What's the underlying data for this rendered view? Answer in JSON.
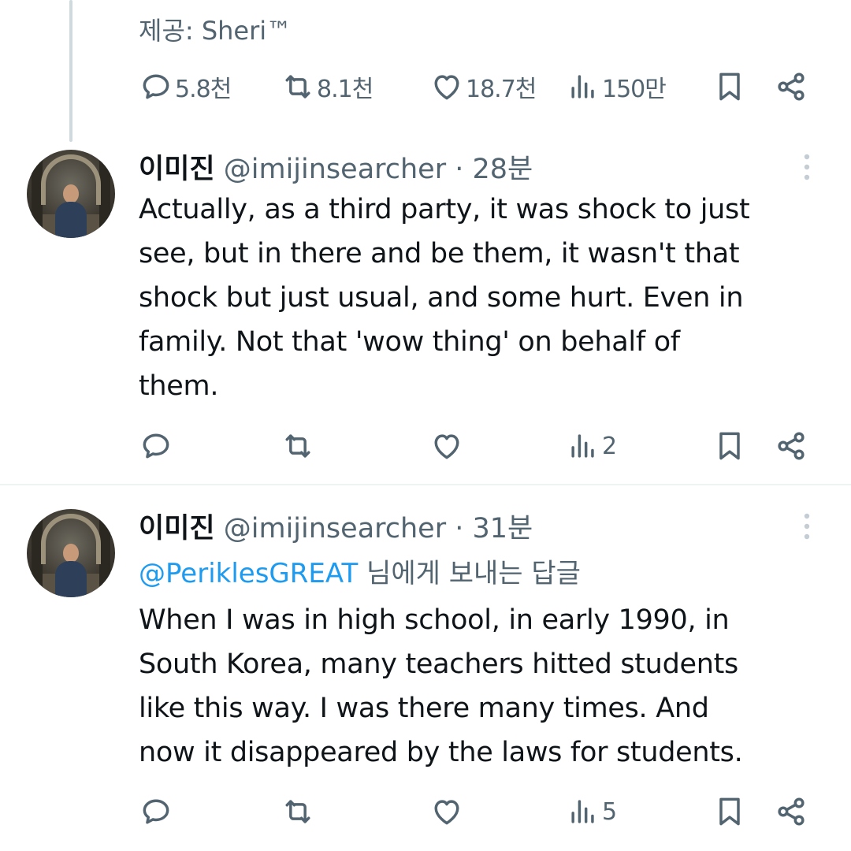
{
  "top": {
    "credit": "제공: Sheri™",
    "actions": {
      "replies": "5.8천",
      "reposts": "8.1천",
      "likes": "18.7천",
      "views": "150만"
    }
  },
  "tweets": [
    {
      "name": "이미진",
      "handle": "@imijinsearcher",
      "time": "· 28분",
      "text": "Actually, as a third party, it was shock to just\nsee, but in there and be them, it wasn't that\nshock but just usual, and some hurt. Even in\nfamily. Not that 'wow thing' on behalf of\nthem.",
      "actions": {
        "views": "2"
      }
    },
    {
      "name": "이미진",
      "handle": "@imijinsearcher",
      "time": "· 31분",
      "reply_to_user": "@PeriklesGREAT",
      "reply_to_suffix": " 님에게 보내는 답글",
      "text": "When I was in high school, in early 1990, in\nSouth Korea, many teachers hitted students\nlike this way. I was there many times. And\nnow it disappeared by the laws for students.",
      "actions": {
        "views": "5"
      }
    }
  ],
  "icons": [
    "reply-icon",
    "repost-icon",
    "like-icon",
    "views-icon",
    "bookmark-icon",
    "share-icon",
    "more-icon"
  ],
  "colors": {
    "muted": "#536471",
    "text": "#0f1419",
    "link": "#1d9bf0",
    "divider": "#eff3f4",
    "thread": "#cfd9de"
  }
}
